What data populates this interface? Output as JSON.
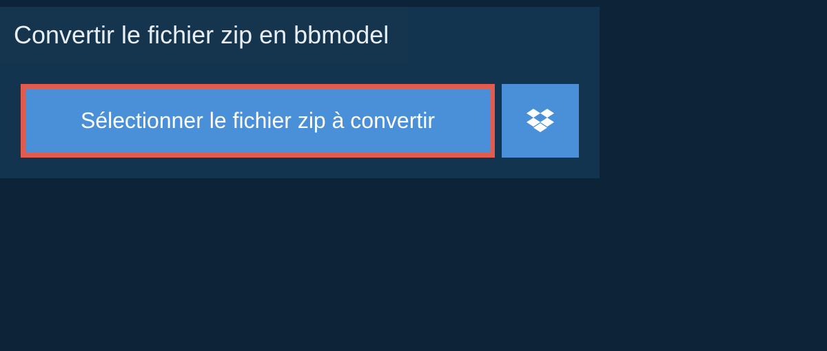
{
  "header": {
    "title": "Convertir le fichier zip en bbmodel"
  },
  "buttons": {
    "select_file_label": "Sélectionner le fichier zip à convertir"
  },
  "colors": {
    "background": "#0d2438",
    "panel": "#12344f",
    "header_tab": "#15354e",
    "button_primary": "#4a90d9",
    "highlight_border": "#e15b4e",
    "text_light": "#e8eef2",
    "text_white": "#ffffff"
  }
}
